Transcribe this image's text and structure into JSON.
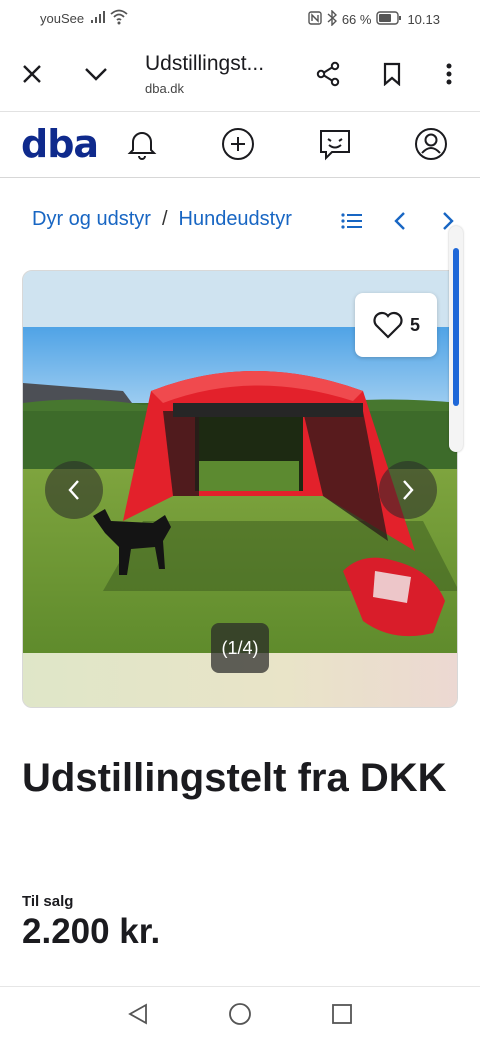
{
  "status": {
    "carrier": "youSee",
    "battery": "66 %",
    "time": "10.13"
  },
  "browser": {
    "page_title": "Udstillingst...",
    "domain": "dba.dk"
  },
  "app": {
    "logo": "dba",
    "brand_color": "#0f2a8c"
  },
  "breadcrumb": {
    "items": [
      "Dyr og udstyr",
      "Hundeudstyr"
    ],
    "separator": "/",
    "link_color": "#1866c3"
  },
  "gallery": {
    "favorite_count": "5",
    "counter": "(1/4)",
    "scroll_position": 0.3
  },
  "listing": {
    "title": "Udstillingstelt fra DKK",
    "sale_type": "Til salg",
    "price": "2.200 kr."
  }
}
